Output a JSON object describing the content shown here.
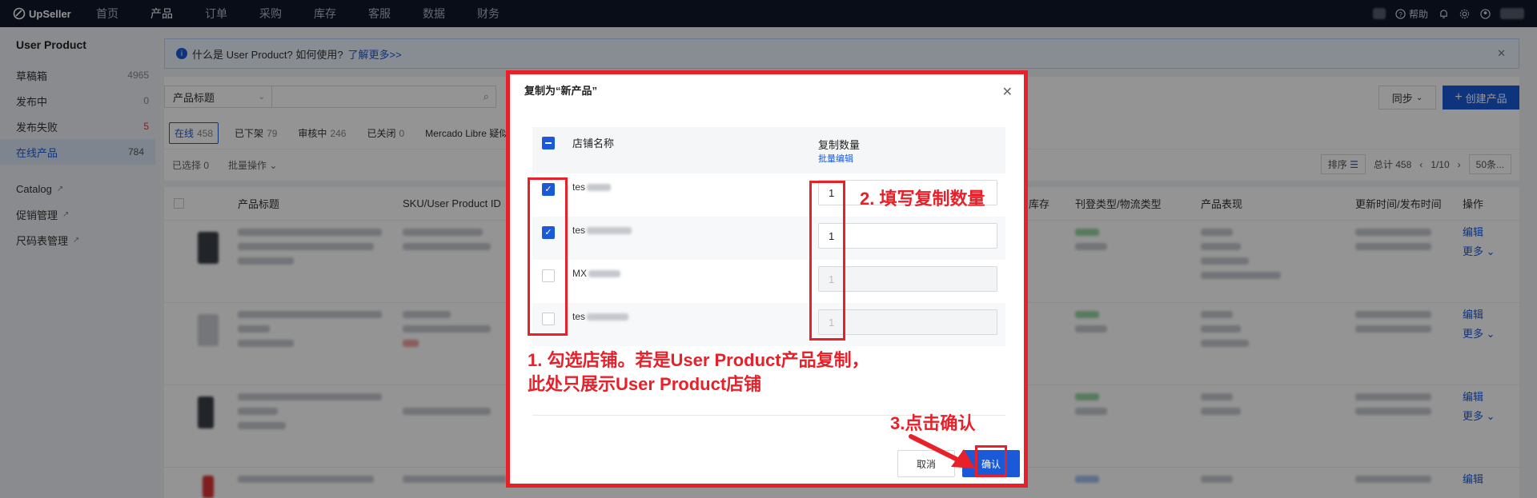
{
  "topnav": {
    "logo": "UpSeller",
    "items": [
      "首页",
      "产品",
      "订单",
      "采购",
      "库存",
      "客服",
      "数据",
      "财务"
    ],
    "active_index": 1,
    "help": "帮助"
  },
  "sidebar": {
    "title": "User Product",
    "items": [
      {
        "label": "草稿箱",
        "count": "4965"
      },
      {
        "label": "发布中",
        "count": "0"
      },
      {
        "label": "发布失败",
        "count": "5"
      },
      {
        "label": "在线产品",
        "count": "784"
      }
    ],
    "links": [
      "Catalog",
      "促销管理",
      "尺码表管理"
    ]
  },
  "main": {
    "info": "什么是 User Product? 如何使用?",
    "info_link": "了解更多>>",
    "filter_select": "产品标题",
    "sync": "同步",
    "create": "创建产品",
    "tabs": [
      {
        "label": "在线",
        "n": "458"
      },
      {
        "label": "已下架",
        "n": "79"
      },
      {
        "label": "审核中",
        "n": "246"
      },
      {
        "label": "已关闭",
        "n": "0"
      },
      {
        "label": "Mercado Libre 疑似",
        "n": ""
      }
    ],
    "selected": "已选择 0",
    "batch_ops": "批量操作",
    "sort": "排序",
    "total": "总计 458",
    "page": "1/10",
    "per_page": "50条...",
    "columns": [
      "产品标题",
      "SKU/User Product ID",
      "库存",
      "刊登类型/物流类型",
      "产品表现",
      "更新时间/发布时间",
      "操作"
    ],
    "row_link_edit": "编辑",
    "row_link_more": "更多"
  },
  "modal": {
    "title": "复制为“新产品”",
    "col_store": "店铺名称",
    "col_qty": "复制数量",
    "batch_edit": "批量编辑",
    "rows": [
      {
        "store_prefix": "tes",
        "checked": true,
        "qty": "1",
        "disabled": false
      },
      {
        "store_prefix": "tes",
        "checked": true,
        "qty": "1",
        "disabled": false
      },
      {
        "store_prefix": "MX",
        "checked": false,
        "qty": "1",
        "disabled": true
      },
      {
        "store_prefix": "tes",
        "checked": false,
        "qty": "1",
        "disabled": true
      }
    ],
    "cancel": "取消",
    "confirm": "确认"
  },
  "annotations": {
    "step1_line1": "1. 勾选店铺。若是User Product产品复制，",
    "step1_line2": "此处只展示User Product店铺",
    "step2": "2. 填写复制数量",
    "step3": "3.点击确认",
    "color": "#e8202a"
  }
}
